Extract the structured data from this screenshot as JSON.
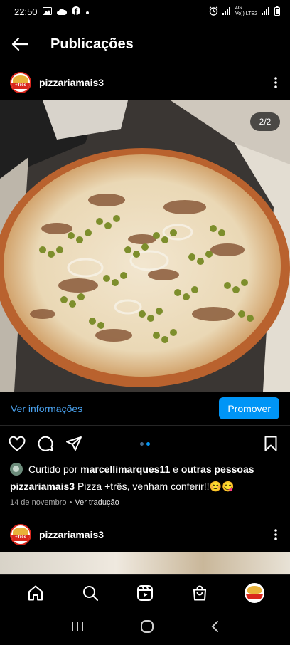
{
  "status_bar": {
    "time": "22:50",
    "network": "Vo)) LTE2",
    "network_gen": "4G",
    "icons_left": [
      "gallery-icon",
      "cloud-icon",
      "facebook-icon",
      "dot-icon"
    ],
    "icons_right": [
      "alarm-icon",
      "signal-icon",
      "signal-icon",
      "battery-icon"
    ]
  },
  "header": {
    "title": "Publicações"
  },
  "post": {
    "username": "pizzariamais3",
    "avatar_band_text": "+Três",
    "image_counter": "2/2",
    "view_insights_label": "Ver informações",
    "promote_label": "Promover",
    "liked_by_prefix": "Curtido por",
    "liked_by_user": "marcellimarques11",
    "liked_by_conj": "e",
    "liked_by_others": "outras pessoas",
    "caption_user": "pizzariamais3",
    "caption_text": "Pizza +três, venham conferir!!😊😋",
    "date": "14 de novembro",
    "separator": "•",
    "translate_label": "Ver tradução"
  },
  "next_post": {
    "username": "pizzariamais3",
    "avatar_band_text": "+Três"
  },
  "colors": {
    "accent_blue": "#0095f6",
    "link_blue": "#4aa3f0",
    "dot_active": "#0095f6",
    "dot_inactive": "#4a6a8a"
  }
}
